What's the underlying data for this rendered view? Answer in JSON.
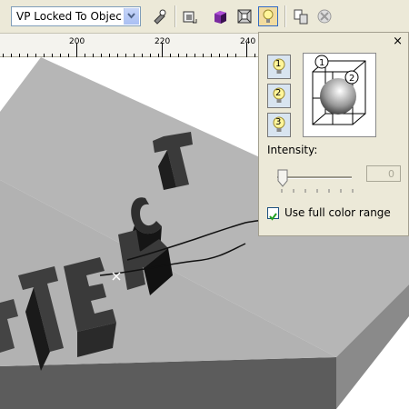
{
  "toolbar": {
    "vanishing_point_value": "VP Locked To Objec",
    "icons": [
      "edit-vanishing-point-icon",
      "rotate-view-icon",
      "extrude-color-icon",
      "bevel-icon",
      "lighting-icon",
      "copy-extrude-properties-icon",
      "clear-extrude-icon"
    ]
  },
  "ruler": {
    "labels": [
      "200",
      "220",
      "240"
    ]
  },
  "lighting_panel": {
    "close_label": "×",
    "light_buttons": [
      "1",
      "2",
      "3"
    ],
    "preview_markers": [
      "1",
      "2"
    ],
    "intensity_label": "Intensity:",
    "intensity_value": "0",
    "full_color_range_label": "Use full color range",
    "full_color_range_checked": true
  },
  "canvas": {
    "text": "ТЕКСТ"
  },
  "colors": {
    "highlight": "#316ac5",
    "panel": "#ece9d8",
    "object": "#b4b4b4"
  }
}
